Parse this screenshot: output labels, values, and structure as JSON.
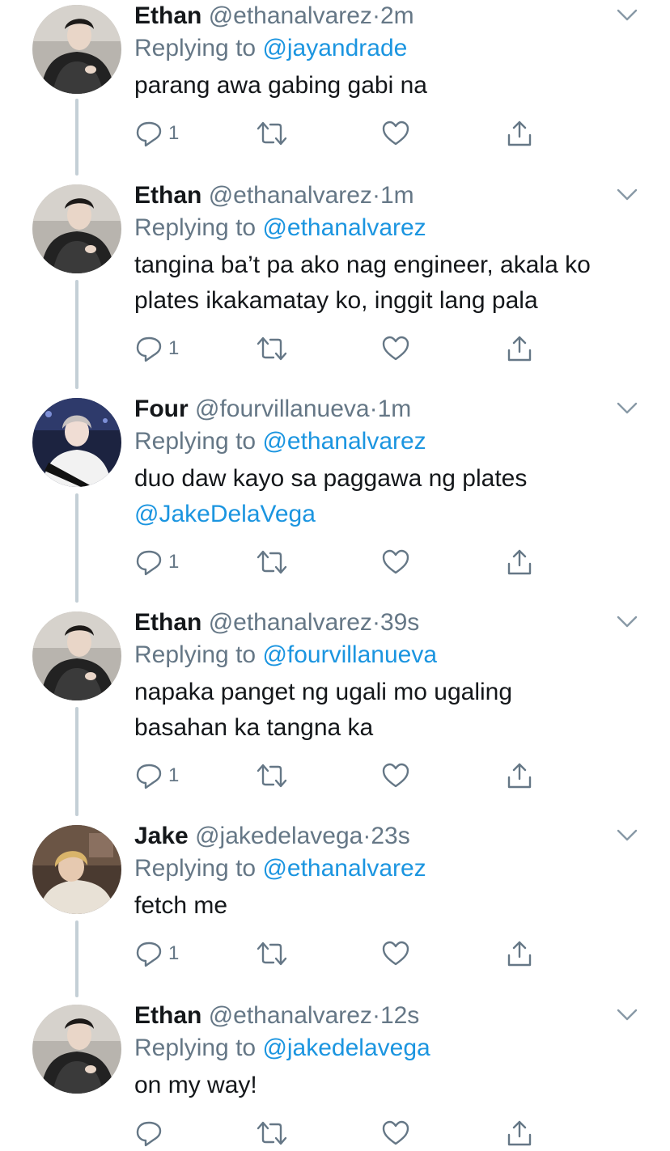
{
  "colors": {
    "text": "#14171a",
    "muted": "#657786",
    "link": "#1b95e0",
    "thread_line": "#c4cfd6"
  },
  "icons": {
    "reply": "reply-icon",
    "retweet": "retweet-icon",
    "like": "heart-icon",
    "share": "share-icon",
    "menu": "chevron-down-icon"
  },
  "tweets": [
    {
      "name": "Ethan",
      "handle": "@ethanalvarez",
      "sep": "·",
      "time": "2m",
      "replying_prefix": "Replying to",
      "replying_to": "@jayandrade",
      "text_lines": [
        "parang awa gabing gabi na"
      ],
      "mention_line": "",
      "reply_count": "1"
    },
    {
      "name": "Ethan",
      "handle": "@ethanalvarez",
      "sep": "·",
      "time": "1m",
      "replying_prefix": "Replying to",
      "replying_to": "@ethanalvarez",
      "text_lines": [
        "tangina ba’t pa ako nag engineer, akala ko",
        "plates ikakamatay ko, inggit lang pala"
      ],
      "mention_line": "",
      "reply_count": "1"
    },
    {
      "name": "Four",
      "handle": "@fourvillanueva",
      "sep": "·",
      "time": "1m",
      "replying_prefix": "Replying to",
      "replying_to": "@ethanalvarez",
      "text_lines": [
        "duo daw kayo sa paggawa ng plates"
      ],
      "mention_line": "@JakeDelaVega",
      "reply_count": "1"
    },
    {
      "name": "Ethan",
      "handle": "@ethanalvarez",
      "sep": "·",
      "time": "39s",
      "replying_prefix": "Replying to",
      "replying_to": "@fourvillanueva",
      "text_lines": [
        "napaka panget ng ugali mo ugaling",
        "basahan ka tangna ka"
      ],
      "mention_line": "",
      "reply_count": "1"
    },
    {
      "name": "Jake",
      "handle": "@jakedelavega",
      "sep": "·",
      "time": "23s",
      "replying_prefix": "Replying to",
      "replying_to": "@ethanalvarez",
      "text_lines": [
        "fetch me"
      ],
      "mention_line": "",
      "reply_count": "1"
    },
    {
      "name": "Ethan",
      "handle": "@ethanalvarez",
      "sep": "·",
      "time": "12s",
      "replying_prefix": "Replying to",
      "replying_to": "@jakedelavega",
      "text_lines": [
        "on my way!"
      ],
      "mention_line": "",
      "reply_count": ""
    }
  ]
}
